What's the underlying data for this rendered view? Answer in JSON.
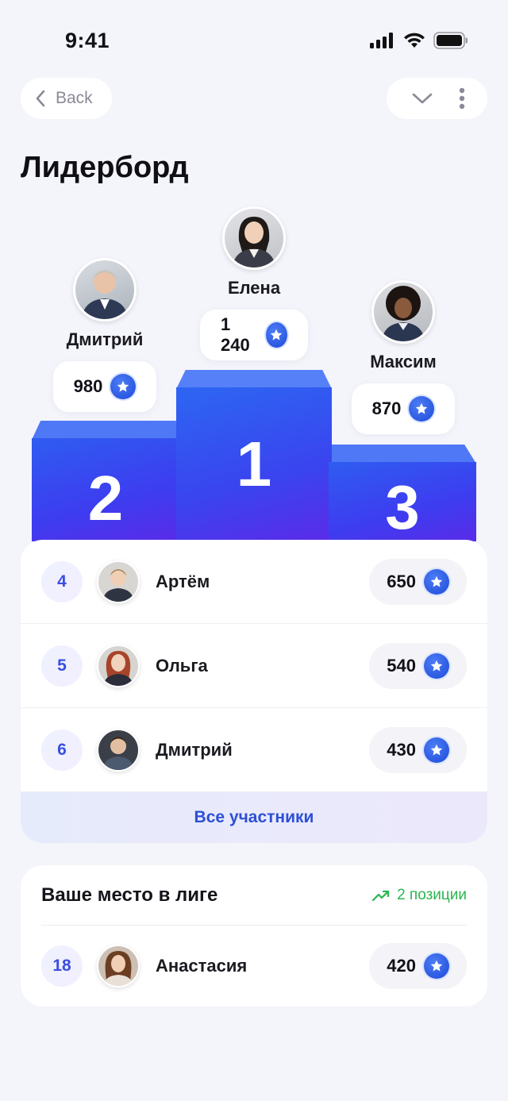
{
  "status": {
    "time": "9:41"
  },
  "nav": {
    "back_label": "Back"
  },
  "page": {
    "title": "Лидерборд"
  },
  "podium": [
    {
      "place": "2",
      "name": "Дмитрий",
      "score": "980"
    },
    {
      "place": "1",
      "name": "Елена",
      "score": "1 240"
    },
    {
      "place": "3",
      "name": "Максим",
      "score": "870"
    }
  ],
  "rankings": [
    {
      "rank": "4",
      "name": "Артём",
      "score": "650"
    },
    {
      "rank": "5",
      "name": "Ольга",
      "score": "540"
    },
    {
      "rank": "6",
      "name": "Дмитрий",
      "score": "430"
    }
  ],
  "all_participants_label": "Все участники",
  "league": {
    "title": "Ваше место в лиге",
    "trend_label": "2 позиции",
    "user": {
      "rank": "18",
      "name": "Анастасия",
      "score": "420"
    }
  },
  "colors": {
    "accent": "#2d4fd6",
    "podium_blue": "#3a44ef",
    "trend_green": "#2bb54f",
    "background": "#f4f4fb"
  },
  "icons": {
    "back": "chevron-left-icon",
    "collapse": "chevron-down-icon",
    "more": "more-vertical-icon",
    "points": "star-badge-icon",
    "trend": "trending-up-icon"
  }
}
